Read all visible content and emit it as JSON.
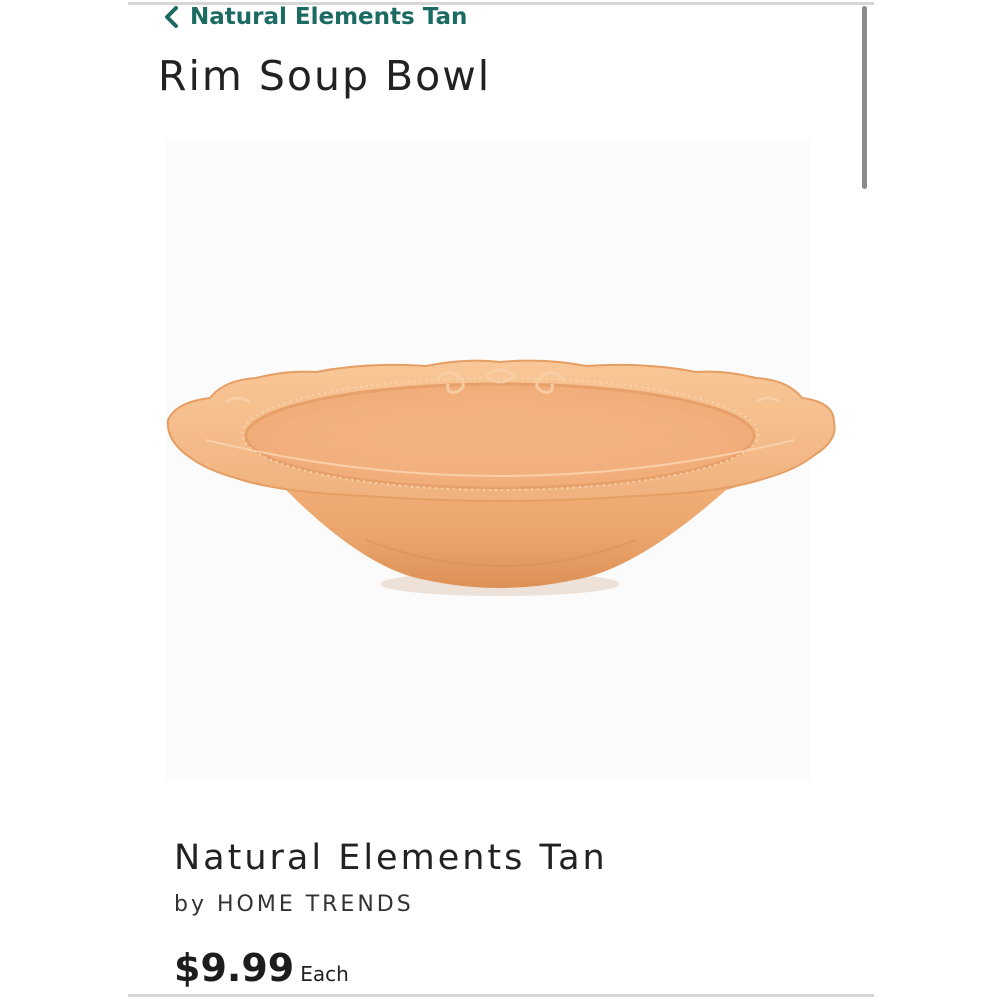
{
  "nav": {
    "back_label": "Natural Elements Tan",
    "back_icon": "chevron-left-icon"
  },
  "header": {
    "title": "Rim Soup Bowl"
  },
  "product": {
    "image_alt": "Rim Soup Bowl",
    "pattern_name": "Natural Elements Tan",
    "byline": "by HOME TRENDS",
    "price": "$9.99",
    "price_unit": "Each"
  },
  "colors": {
    "link_accent": "#1c6b63",
    "bowl_glaze": "#f0b07a"
  }
}
